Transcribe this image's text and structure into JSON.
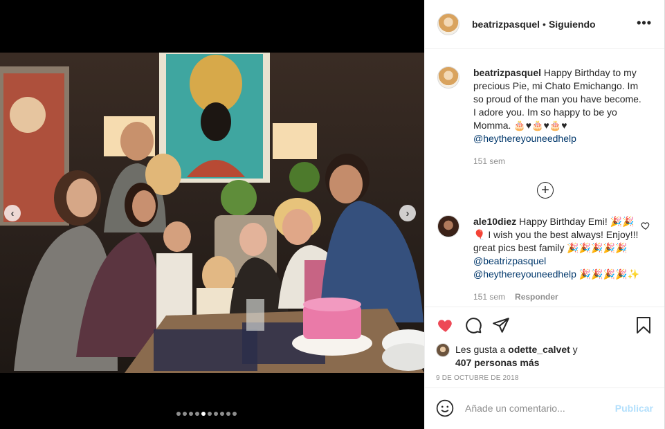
{
  "post": {
    "author": "beatrizpasquel",
    "separator": "•",
    "follow_status": "Siguiendo",
    "more_icon": "more-options-icon"
  },
  "caption": {
    "user": "beatrizpasquel",
    "text": "Happy Birthday to my precious Pie, mi Chato Emichango. Im so proud of the man you have become. I adore you. Im so happy to be yo Momma. 🎂♥🎂♥🎂♥",
    "mention": "@heythereyouneedhelp",
    "time": "151 sem"
  },
  "load_more_icon": "plus-circle-icon",
  "comments": [
    {
      "user": "ale10diez",
      "text": "Happy Birthday Emi! 🎉🎉🎈 I wish you the best always! Enjoy!!! great pics best family 🎉🎉🎉🎉🎉",
      "mention1": "@beatrizpasquel",
      "mention2": "@heythereyouneedhelp",
      "tail": "🎉🎉🎉🎉✨",
      "time": "151 sem",
      "reply": "Responder"
    }
  ],
  "likes": {
    "prefix": "Les gusta a ",
    "user": "odette_calvet",
    "suffix": " y",
    "count_text": "407 personas más"
  },
  "date": "9 DE OCTUBRE DE 2018",
  "add_comment": {
    "placeholder": "Añade un comentario...",
    "publish": "Publicar"
  },
  "carousel": {
    "total": 10,
    "active_index": 4
  },
  "colors": {
    "like_active": "#ed4956",
    "link": "#00376b",
    "publish_disabled": "#b2dffc",
    "muted": "#8e8e8e"
  }
}
